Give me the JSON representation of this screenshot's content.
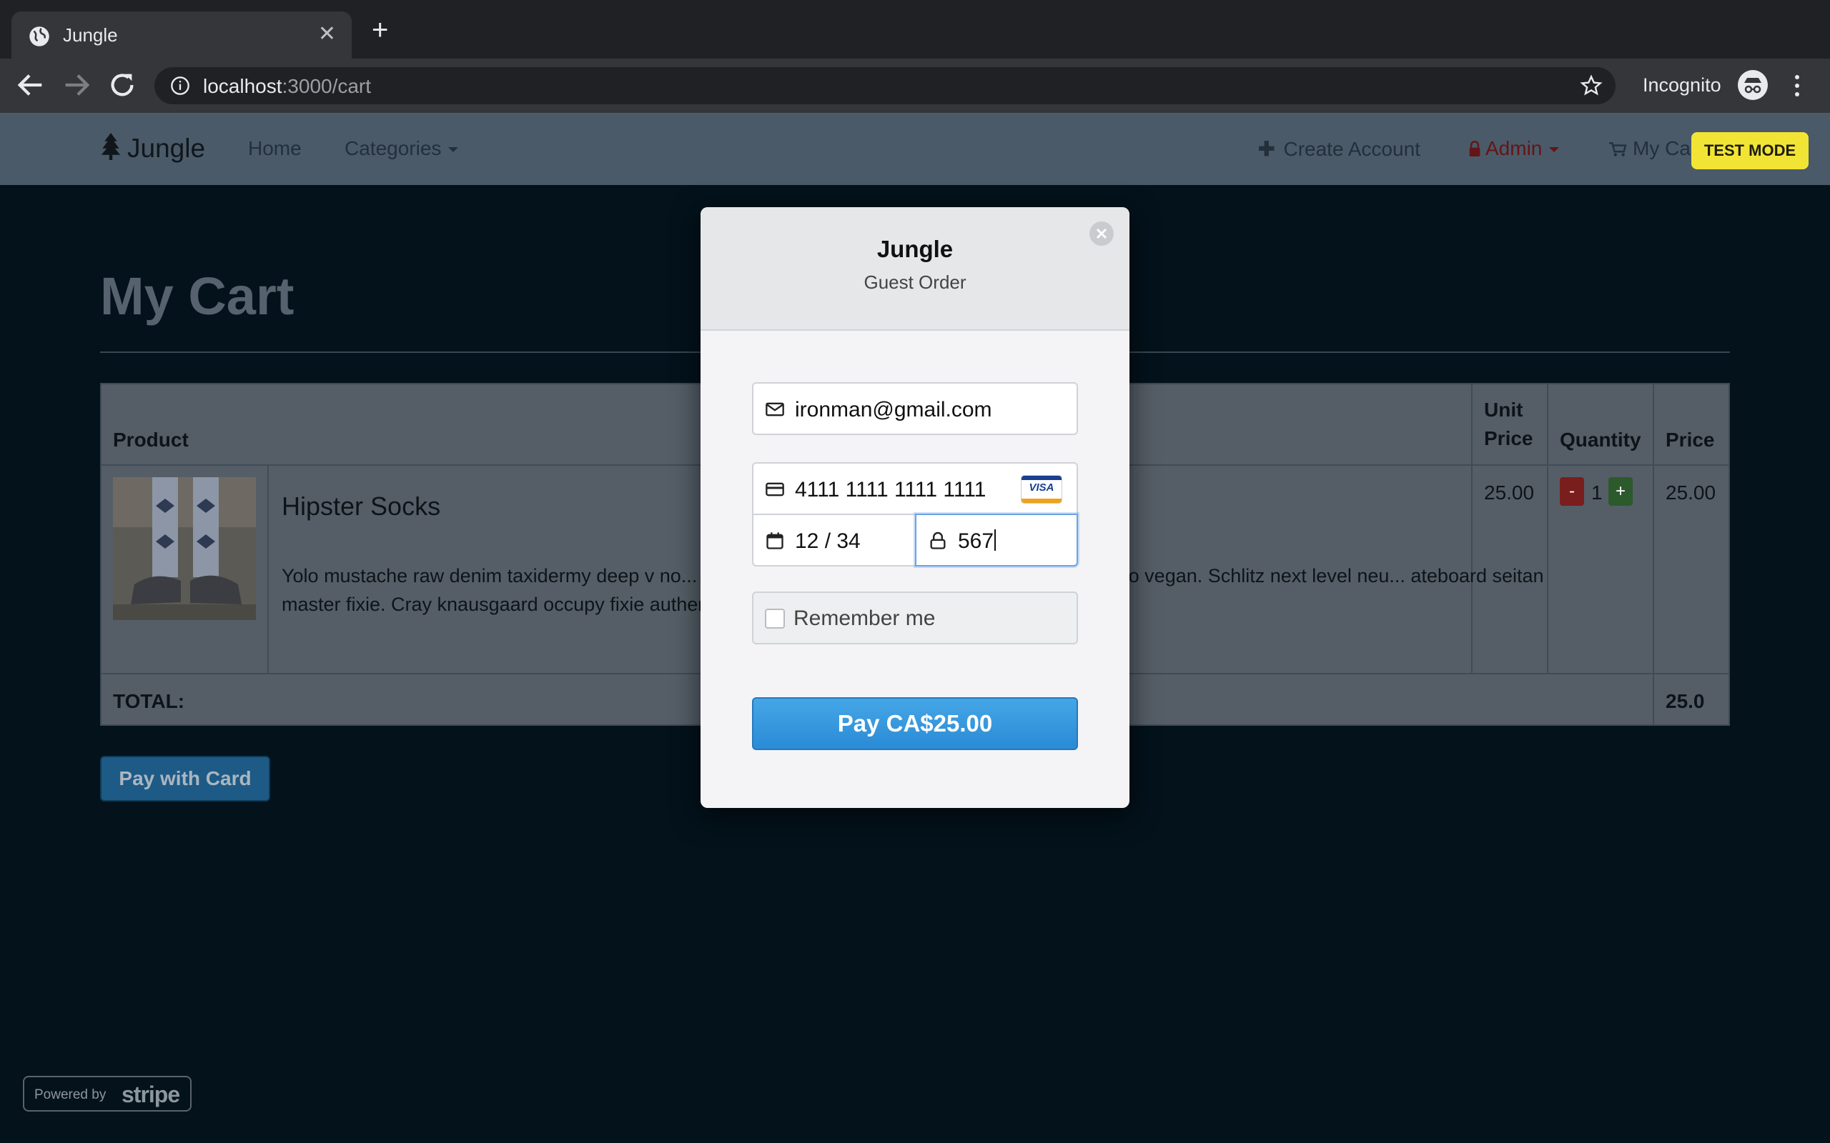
{
  "browser": {
    "tab_title": "Jungle",
    "url_host": "localhost",
    "url_path": ":3000/cart",
    "incognito_label": "Incognito"
  },
  "nav": {
    "brand": "Jungle",
    "home": "Home",
    "categories": "Categories",
    "create_account": "Create Account",
    "admin": "Admin",
    "my_cart": "My Ca",
    "test_mode": "TEST MODE"
  },
  "page": {
    "title": "My Cart",
    "table": {
      "headers": {
        "product": "Product",
        "unit_price_1": "Unit",
        "unit_price_2": "Price",
        "quantity": "Quantity",
        "price": "Price"
      },
      "rows": [
        {
          "name": "Hipster Socks",
          "description": "Yolo mustache raw denim taxidermy deep v no... etro humblebrag. Yolo goth 8-bit cold-pressed lomo vegan. Schlitz next level neu... ateboard seitan master fixie. Cray knausgaard occupy fixie authentic retro cardiga...",
          "unit_price": "25.00",
          "quantity": "1",
          "price": "25.00",
          "minus": "-",
          "plus": "+"
        }
      ],
      "total_label": "TOTAL:",
      "total_value": "25.0"
    },
    "pay_with_card": "Pay with Card"
  },
  "powered": {
    "prefix": "Powered by",
    "brand": "stripe"
  },
  "modal": {
    "title": "Jungle",
    "subtitle": "Guest Order",
    "email": "ironman@gmail.com",
    "card_number": "4111 1111 1111 1111",
    "card_brand": "VISA",
    "expiry": "12 / 34",
    "cvc": "567",
    "remember_me": "Remember me",
    "pay_button": "Pay CA$25.00"
  },
  "colors": {
    "page_bg": "#03121b",
    "test_mode": "#f2e435",
    "pay_button": "#2a8bd6",
    "focus_ring": "#6aa3e8"
  }
}
